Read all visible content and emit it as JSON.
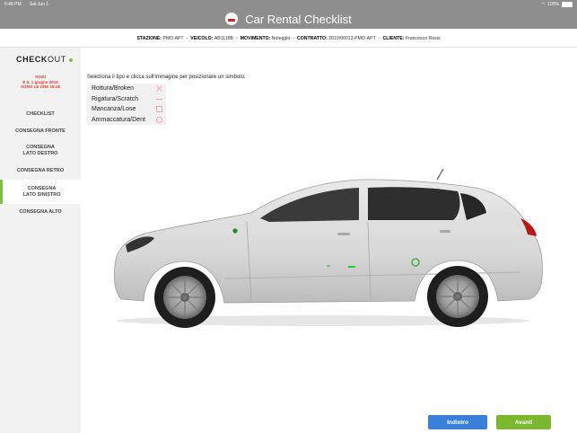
{
  "status": {
    "time": "6:48 PM",
    "date": "Sat Jun 1",
    "battery": "100%"
  },
  "app": {
    "title": "Car Rental Checklist"
  },
  "info": [
    {
      "label": "STAZIONE:",
      "value": "PMO APT"
    },
    {
      "label": "VEICOLO:",
      "value": "AB1118B"
    },
    {
      "label": "MOVIMENTO:",
      "value": "Noleggio"
    },
    {
      "label": "CONTRATTO:",
      "value": "2019/00013 PMO-APT"
    },
    {
      "label": "CLIENTE:",
      "value": "Francesco Rossi"
    }
  ],
  "sidebar": {
    "title_bold": "CHECK",
    "title_rest": "OUT",
    "date_lines": [
      "OGGI",
      "È IL 1 giugno 2019",
      "SONO LE ORE 18:48"
    ],
    "items": [
      {
        "label": "CHECKLIST"
      },
      {
        "label": "CONSEGNA FRONTE"
      },
      {
        "label": "CONSEGNA\nLATO DESTRO"
      },
      {
        "label": "CONSEGNA RETRO"
      },
      {
        "label": "CONSEGNA\nLATO SINISTRO"
      },
      {
        "label": "CONSEGNA ALTO"
      }
    ]
  },
  "main": {
    "instruction": "Seleziona il tipo e clicca sull'immagine per posizionare un simbolo.",
    "legend": [
      {
        "label": "Rottura/Broken",
        "icon": "x-icon"
      },
      {
        "label": "Rigatura/Scratch",
        "icon": "line-icon"
      },
      {
        "label": "Mancanza/Lose",
        "icon": "square-icon"
      },
      {
        "label": "Ammaccatura/Dent",
        "icon": "circle-icon"
      }
    ]
  },
  "buttons": {
    "back": "Indietro",
    "next": "Avanti"
  },
  "colors": {
    "accent": "#7bc043",
    "back_button": "#3b80d8",
    "next_button": "#7cb82f",
    "alert": "#e23a2e",
    "marker": "#2ec63a"
  }
}
